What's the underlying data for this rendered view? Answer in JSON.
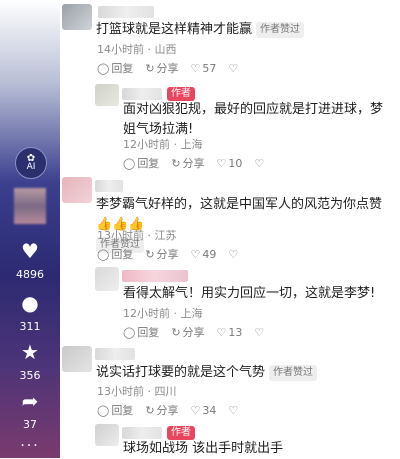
{
  "sidebar": {
    "ai_label": "AI",
    "likes": "4896",
    "comments": "311",
    "favorites": "356",
    "shares": "37",
    "more": "···"
  },
  "actions": {
    "reply": "回复",
    "share": "分享"
  },
  "badges": {
    "author": "作者",
    "liked_by_author": "作者赞过"
  },
  "comments": [
    {
      "text": "打篮球就是这样精神才能赢",
      "meta": "14小时前 · 山西",
      "likes": "57"
    },
    {
      "text": "面对凶狠犯规，最好的回应就是打进进球，梦姐气场拉满!",
      "meta": "12小时前 · 上海",
      "likes": "10"
    },
    {
      "text": "李梦霸气好样的，这就是中国军人的风范为你点赞 👍👍👍",
      "meta": "13小时前 · 江苏",
      "likes": "49"
    },
    {
      "text": "看得太解气！用实力回应一切，这就是李梦!",
      "meta": "12小时前 · 上海",
      "likes": "13"
    },
    {
      "text": "说实话打球要的就是这个气势",
      "meta": "13小时前 · 四川",
      "likes": "34"
    },
    {
      "text": "球场如战场  该出手时就出手",
      "meta": "",
      "likes": ""
    }
  ]
}
